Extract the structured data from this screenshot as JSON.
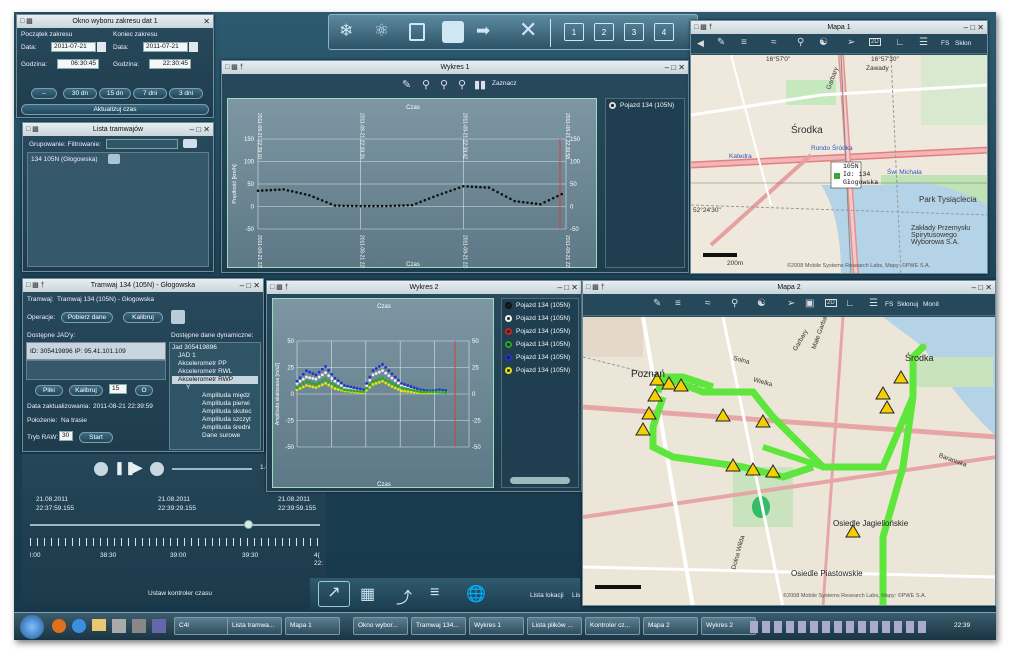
{
  "date_window": {
    "title": "Okno wyboru zakresu dat 1",
    "start_label": "Początek zakresu",
    "end_label": "Koniec zakresu",
    "date_label": "Data:",
    "time_label": "Godzina:",
    "start_date": "2011-07-21",
    "end_date": "2011-07-21",
    "start_time": "06:30:45",
    "end_time": "22:30:45",
    "buttons": [
      "30 dn",
      "15 dn",
      "7 dni",
      "3 dni"
    ],
    "update_label": "Aktualizuj czas"
  },
  "toolbar": {
    "icons": [
      "network-icon",
      "route-icon",
      "lock-icon",
      "driver-icon",
      "export-icon",
      "close-icon"
    ],
    "tabs": [
      "1",
      "2",
      "3",
      "4"
    ]
  },
  "tram_list": {
    "title": "Lista tramwajów",
    "group_label": "Grupowanie: Filtrowanie:",
    "item": "134   105N   (Głogowska)"
  },
  "chart1": {
    "title": "Wykres 1",
    "mark_label": "Zaznacz",
    "axis_top": "Czas",
    "axis_bottom": "Czas",
    "ylabel": "Prędkość [km/h]",
    "legend": [
      "Pojazd 134 (105N)"
    ]
  },
  "chart2": {
    "title": "Wykres 2",
    "axis_top": "Czas",
    "axis_bottom": "Czas",
    "ylabel": "Amplituda skalowana [m/s2]",
    "legend": [
      "Pojazd 134 (105N)",
      "Pojazd 134 (105N)",
      "Pojazd 134 (105N)",
      "Pojazd 134 (105N)",
      "Pojazd 134 (105N)",
      "Pojazd 134 (105N)"
    ],
    "legend_colors": [
      "#111111",
      "#f2f2f2",
      "#cc2222",
      "#22aa22",
      "#2233cc",
      "#e6e600"
    ]
  },
  "chart_data": [
    {
      "type": "line",
      "title": "",
      "ylabel": "Prędkość [km/h]",
      "xlabel": "Czas",
      "ylim": [
        -50,
        150
      ],
      "x": [
        "2011-08-21 22:39:10",
        "2011-08-21 22:39:14",
        "2011-08-21 22:39:18",
        "2011-08-21 22:39:22",
        "2011-08-21 22:39:26",
        "2011-08-21 22:39:30",
        "2011-08-21 22:39:34",
        "2011-08-21 22:39:38",
        "2011-08-21 22:39:42",
        "2011-08-21 22:39:46",
        "2011-08-21 22:39:50",
        "2011-08-21 22:39:54",
        "2011-08-21 22:39:58"
      ],
      "series": [
        {
          "name": "Pojazd 134 (105N)",
          "values": [
            35,
            38,
            25,
            2,
            1,
            1,
            3,
            25,
            45,
            42,
            12,
            5,
            32
          ]
        }
      ]
    },
    {
      "type": "scatter",
      "title": "",
      "ylabel": "Amplituda skalowana [m/s2]",
      "xlabel": "Czas",
      "ylim": [
        -50,
        50
      ],
      "x": [
        "1",
        "2",
        "3",
        "4",
        "5",
        "6",
        "7",
        "8",
        "9",
        "10",
        "11",
        "12",
        "13",
        "14",
        "15",
        "16",
        "17"
      ],
      "series": [
        {
          "name": "Pojazd 134 (105N)",
          "values": [
            4,
            8,
            6,
            10,
            5,
            3,
            2,
            1,
            9,
            12,
            7,
            3,
            2,
            1,
            1,
            2,
            1
          ]
        },
        {
          "name": "Pojazd 134 (105N)",
          "values": [
            10,
            16,
            14,
            20,
            12,
            6,
            4,
            3,
            18,
            22,
            15,
            8,
            5,
            3,
            2,
            3,
            2
          ]
        },
        {
          "name": "Pojazd 134 (105N)",
          "values": [
            12,
            22,
            18,
            26,
            15,
            8,
            6,
            4,
            22,
            28,
            19,
            10,
            7,
            4,
            3,
            4,
            3
          ]
        },
        {
          "name": "Pojazd 134 (105N)",
          "values": [
            6,
            12,
            9,
            14,
            8,
            4,
            3,
            2,
            12,
            15,
            10,
            6,
            4,
            2,
            2,
            2,
            1
          ]
        }
      ]
    }
  ],
  "vehicle_panel": {
    "title": "Tramwaj 134 (105N) - Głogowska",
    "tram_label": "Tramwaj:",
    "tram_value": "Tramwaj 134 (105N) - Głogowska",
    "ops_label": "Operacje:",
    "fetch_label": "Pobierz dane",
    "calibrate_label": "Kalibruj",
    "jads_label": "Dostępne JAD'y:",
    "dyn_label": "Dostępne dane dynamiczne:",
    "id_line": "ID: 305419896   IP: 95.41.101.109",
    "files_label": "Pliki",
    "calib2": "Kalibruj",
    "num": "15",
    "o_label": "O",
    "updated_label": "Data zaktualizowania:",
    "updated_value": "2011-08-21 22:39:59",
    "pos_label": "Położenie:",
    "pos_value": "Na trasie",
    "raw_label": "Tryb RAW:",
    "raw_value": "30",
    "start_label": "Start",
    "tree": [
      "Jad 305419896",
      "JAD 1",
      "Akcelerometr PP",
      "Akcelerometr RWL",
      "Akcelerometr RWP",
      "Y",
      "Amplituda międz",
      "Amplituda pierwi",
      "Amplituda skutec",
      "Amplituda szczyt",
      "Amplituda średni",
      "Dane surowe"
    ]
  },
  "time_control": {
    "speed": "1.00",
    "times": [
      [
        "21.08.2011",
        "22:37:59.155"
      ],
      [
        "21.08.2011",
        "22:39:29.155"
      ],
      [
        "21.08.2011",
        "22:39:59.155"
      ]
    ],
    "ticks": [
      "l:00",
      "38:30",
      "39:00",
      "39:30",
      "4(",
      "22:"
    ],
    "label": "Ustaw kontroler czasu"
  },
  "map1": {
    "title": "Mapa 1",
    "fs": "FS",
    "mode": "Skłon",
    "labels": [
      "Środka",
      "Rondo Śródka",
      "Katedra",
      "Park Tysiąclecia",
      "Zakłady Przemysłu Spirytusowego Wyborowa S.A.",
      "Garbary",
      "Zawady",
      "Św. Michała"
    ],
    "coord_top": [
      "16°57'0\"",
      "16°57'30\""
    ],
    "coord_left": "52°24'30\"",
    "scale": "200m",
    "callout": [
      "105N",
      "Id: 134",
      "Głogowska"
    ],
    "copyright": "©2008 Mobile Systems Research Labs, Mapy: ©PWE S.A."
  },
  "map2": {
    "title": "Mapa 2",
    "fs": "FS",
    "mode": "Skłonuj",
    "mode2": "Monit",
    "labels": [
      "Poznań",
      "Środka",
      "Osiedle Jagiellońskie",
      "Osiedle Piastowskie",
      "Garbary",
      "Baraniaka",
      "Solna",
      "Wielka",
      "Małe Garbary",
      "Dolna Wilda"
    ],
    "copyright": "©2008 Mobile Systems Research Labs, Mapy: ©PWE S.A."
  },
  "bottom_tools": {
    "icons": [
      "chart-icon",
      "tram-icon",
      "track-icon",
      "layers-icon",
      "world-icon"
    ],
    "list_label": "Lista lokacji",
    "list2": "Lis"
  },
  "taskbar": {
    "items": [
      "C4I",
      "Lista tramwa...",
      "Mapa 1",
      "Okno wybor...",
      "Tramwaj 134...",
      "Wykres 1",
      "Lista plików ...",
      "Kontroler cz...",
      "Mapa 2",
      "Wykres 2"
    ],
    "clock": "22:39"
  }
}
